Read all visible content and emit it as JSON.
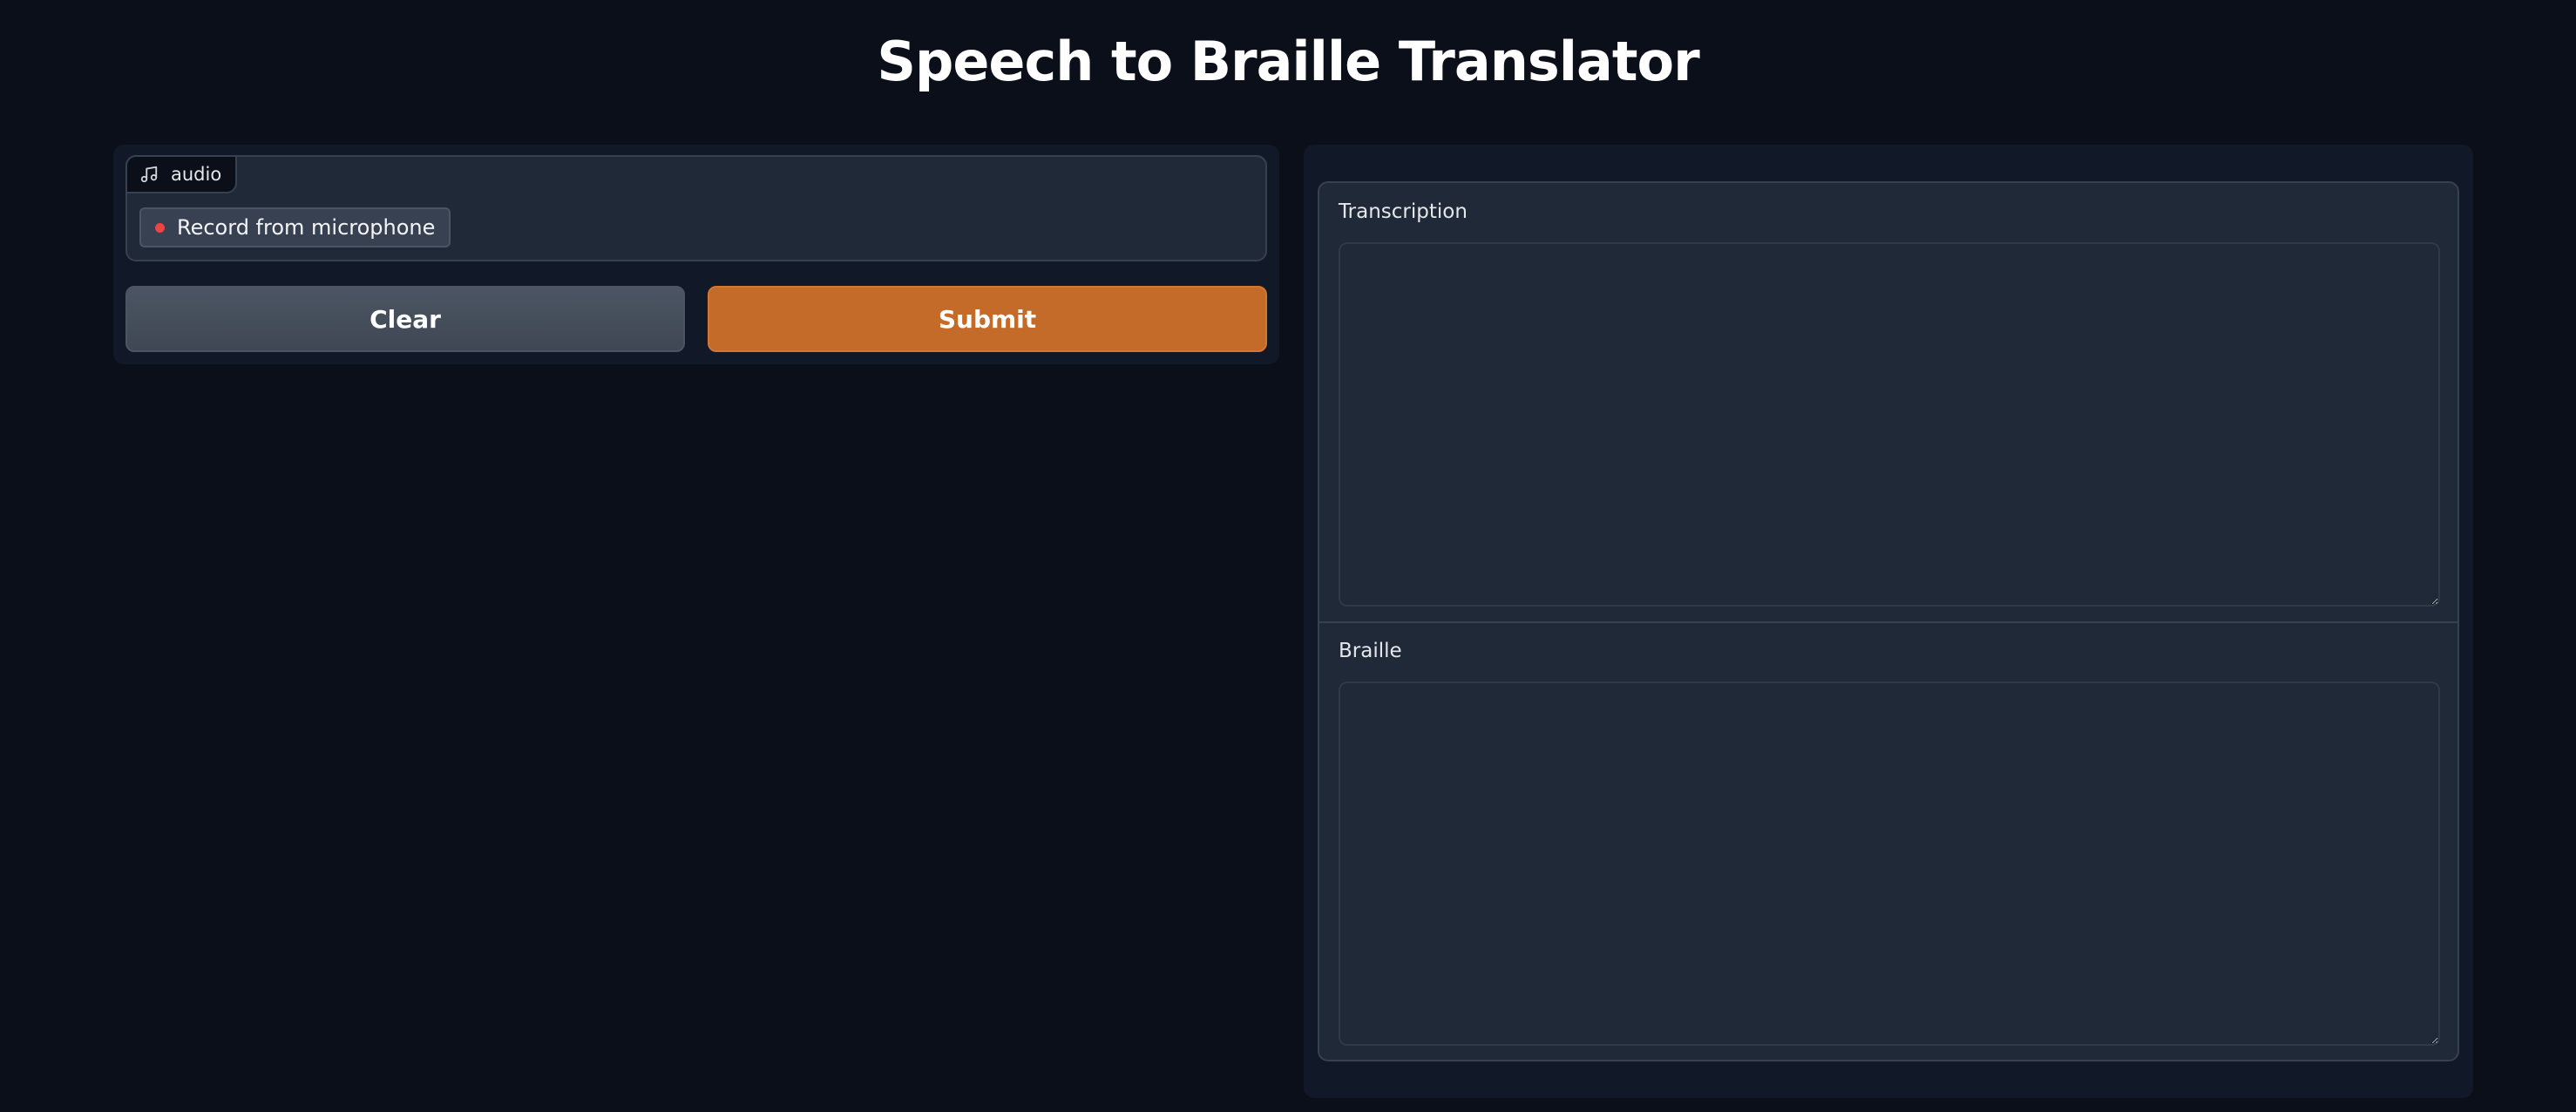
{
  "app": {
    "title": "Speech to Braille Translator"
  },
  "input": {
    "audio_label": "audio",
    "audio_icon": "music-note-icon",
    "record_label": "Record from microphone",
    "record_dot_color": "#ef4444"
  },
  "actions": {
    "clear_label": "Clear",
    "submit_label": "Submit",
    "submit_color": "#c56b2a"
  },
  "output": {
    "transcription_label": "Transcription",
    "transcription_value": "",
    "braille_label": "Braille",
    "braille_value": ""
  }
}
